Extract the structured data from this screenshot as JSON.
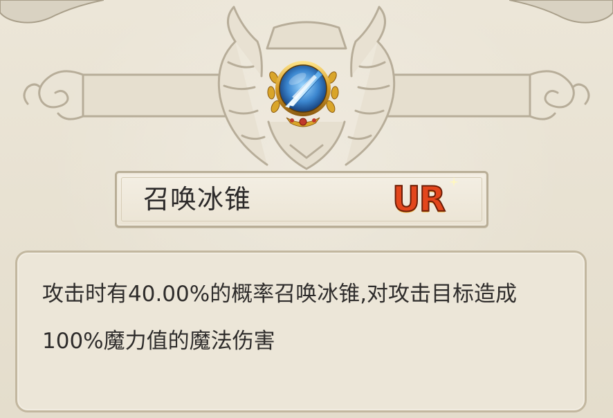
{
  "skill": {
    "name": "召唤冰锥",
    "rarity": "UR",
    "description": "攻击时有40.00%的概率召唤冰锥,对攻击目标造成100%魔力值的魔法伤害",
    "icon": "ice-cone-icon"
  },
  "colors": {
    "background": "#e9e3d4",
    "ornament_stroke": "#b7ad99",
    "rarity_fill": "#e3461c",
    "rarity_outline": "#6b1d08",
    "text": "#2e2c2b"
  }
}
